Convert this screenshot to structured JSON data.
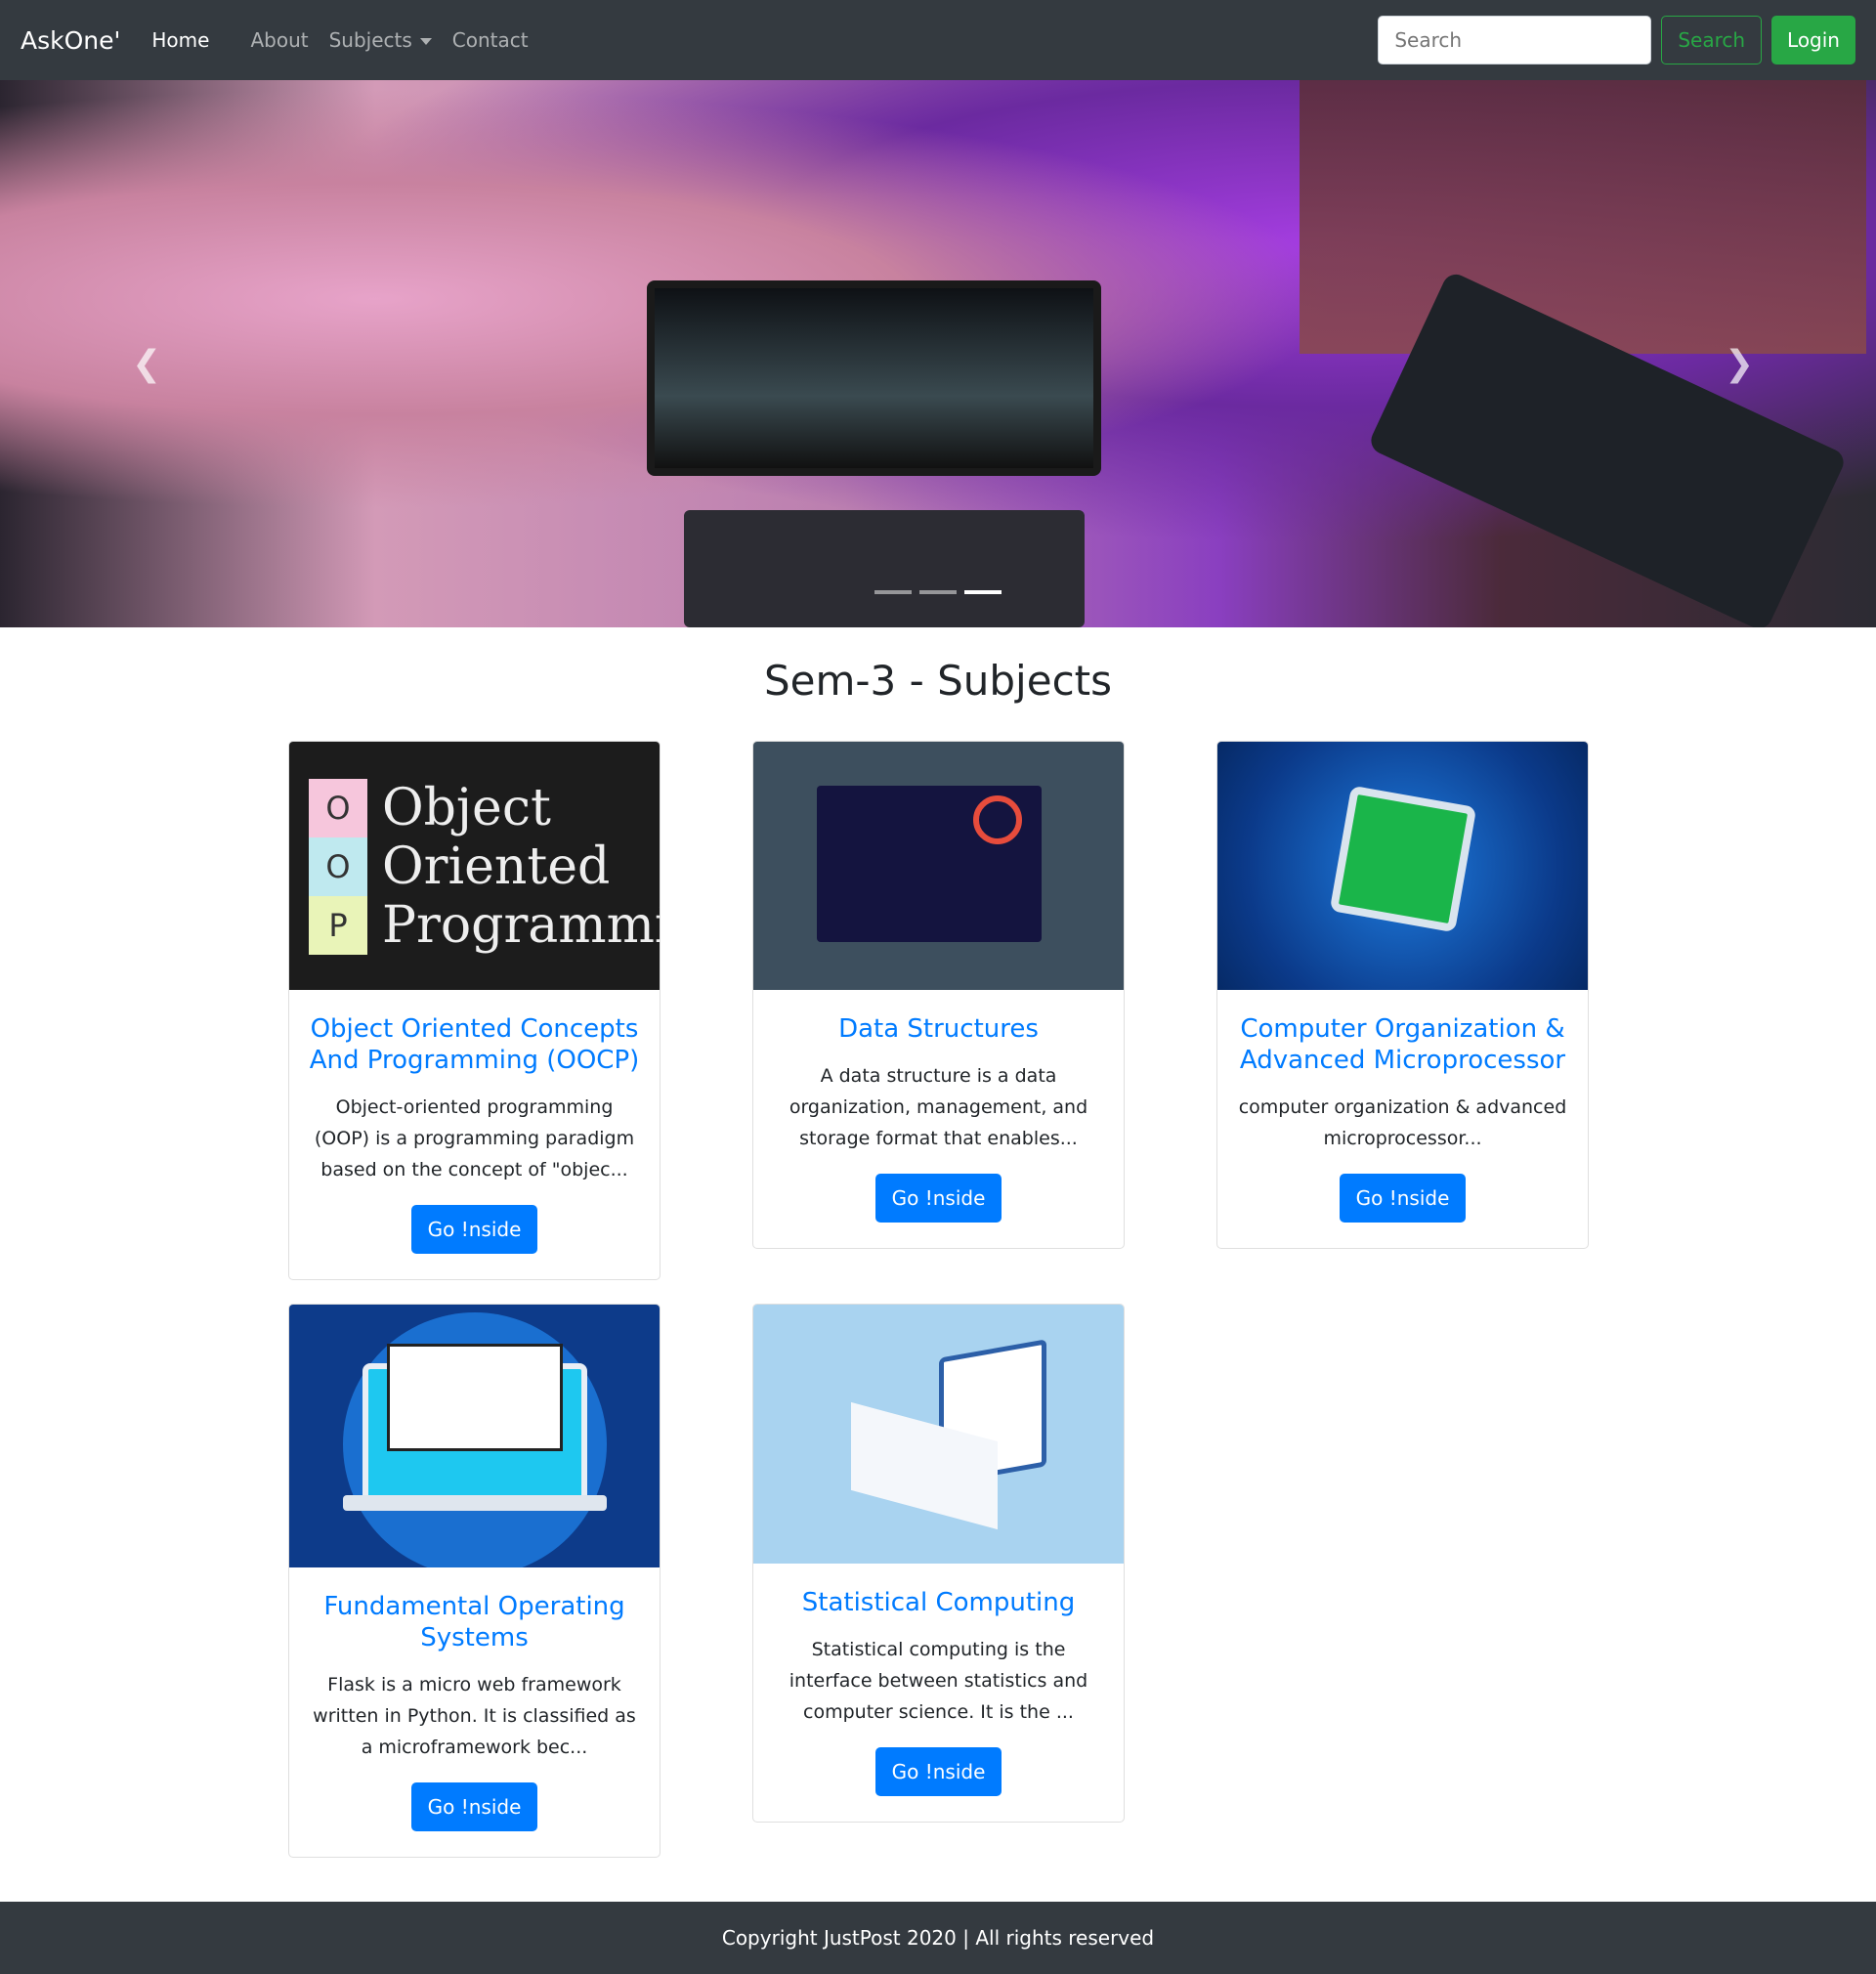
{
  "nav": {
    "brand": "AskOne'",
    "links": [
      "Home",
      "About",
      "Subjects",
      "Contact"
    ],
    "search_placeholder": "Search",
    "search_button": "Search",
    "login": "Login"
  },
  "hero": {
    "slides": 3,
    "active_slide": 3
  },
  "page_title": "Sem-3 - Subjects",
  "cards": [
    {
      "title": "Object Oriented Concepts And Programming (OOCP)",
      "text": "Object-oriented programming (OOP) is a programming paradigm based on the concept of \"objec...",
      "button": "Go !nside",
      "image_text": [
        "O",
        "O",
        "P",
        "Object",
        "Oriented",
        "Programming"
      ]
    },
    {
      "title": "Data Structures",
      "text": "A data structure is a data organization, management, and storage format that enables...",
      "button": "Go !nside"
    },
    {
      "title": "Computer Organization & Advanced Microprocessor",
      "text": "computer organization & advanced microprocessor...",
      "button": "Go !nside"
    },
    {
      "title": "Fundamental Operating Systems",
      "text": "Flask is a micro web framework written in Python. It is classified as a microframework bec...",
      "button": "Go !nside"
    },
    {
      "title": "Statistical Computing",
      "text": "Statistical computing is the interface between statistics and computer science. It is the ...",
      "button": "Go !nside"
    }
  ],
  "footer": "Copyright JustPost 2020 | All rights reserved"
}
